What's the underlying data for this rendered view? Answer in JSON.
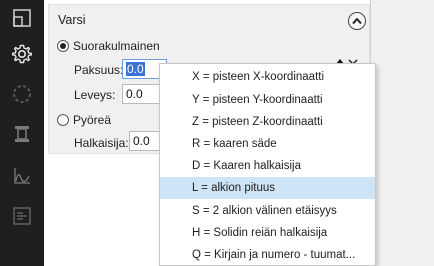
{
  "panel": {
    "group_title": "Varsi",
    "radio_rect_label": "Suorakulmainen",
    "radio_round_label": "Pyöreä",
    "paksuus_label": "Paksuus:",
    "paksuus_value": "0.0",
    "leveys_label": "Leveys:",
    "leveys_value": "0.0",
    "halkaisija_label": "Halkaisija:",
    "halkaisija_value": "0.0",
    "selected_shape": "Suorakulmainen"
  },
  "dropdown": {
    "items": [
      "X  =  pisteen X-koordinaatti",
      "Y  =  pisteen Y-koordinaatti",
      "Z  =  pisteen Z-koordinaatti",
      "R  =  kaaren säde",
      "D  =  Kaaren halkaisija",
      "L  =  alkion pituus",
      "S  =  2 alkion välinen etäisyys",
      "H = Solidin reiän halkaisija",
      "Q = Kirjain ja numero - tuumat..."
    ],
    "highlighted_index": 5
  },
  "toolbar": {
    "icons": [
      "layout-icon",
      "gear-icon",
      "dashed-circle-icon",
      "pillar-icon",
      "curve-graph-icon",
      "panel-icon"
    ],
    "active": "gear-icon"
  },
  "colors": {
    "toolbar_bg": "#1f1f1f",
    "panel_bg": "#f0f0f0",
    "highlight": "#cde3f6",
    "selection": "#3875d6"
  }
}
